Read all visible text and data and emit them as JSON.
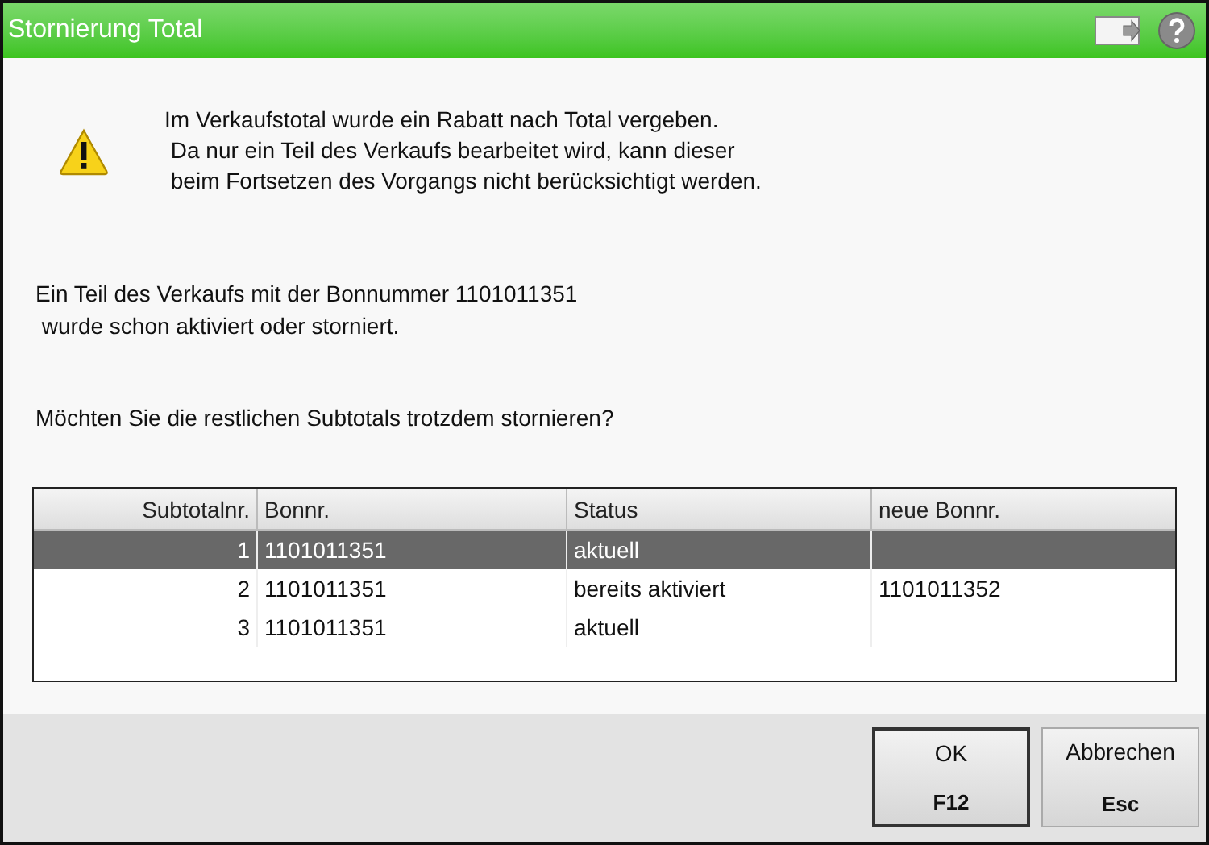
{
  "window": {
    "title": "Stornierung Total"
  },
  "message": {
    "kind": "warning",
    "text": "Im Verkaufstotal wurde ein Rabatt nach Total vergeben.\n Da nur ein Teil des Verkaufs bearbeitet wird, kann dieser\n beim Fortsetzen des Vorgangs nicht berücksichtigt werden."
  },
  "info": "Ein Teil des Verkaufs mit der Bonnummer 1101011351\n wurde schon aktiviert oder storniert.",
  "question": "Möchten Sie die restlichen Subtotals trotzdem stornieren?",
  "table": {
    "columns": [
      "Subtotalnr.",
      "Bonnr.",
      "Status",
      "neue Bonnr."
    ],
    "rows": [
      {
        "cells": [
          "1",
          "1101011351",
          "aktuell",
          ""
        ],
        "selected": true
      },
      {
        "cells": [
          "2",
          "1101011351",
          "bereits aktiviert",
          "1101011352"
        ],
        "selected": false
      },
      {
        "cells": [
          "3",
          "1101011351",
          "aktuell",
          ""
        ],
        "selected": false
      }
    ]
  },
  "buttons": [
    {
      "label": "OK",
      "key": "F12",
      "default": true
    },
    {
      "label": "Abbrechen",
      "key": "Esc",
      "default": false
    }
  ]
}
